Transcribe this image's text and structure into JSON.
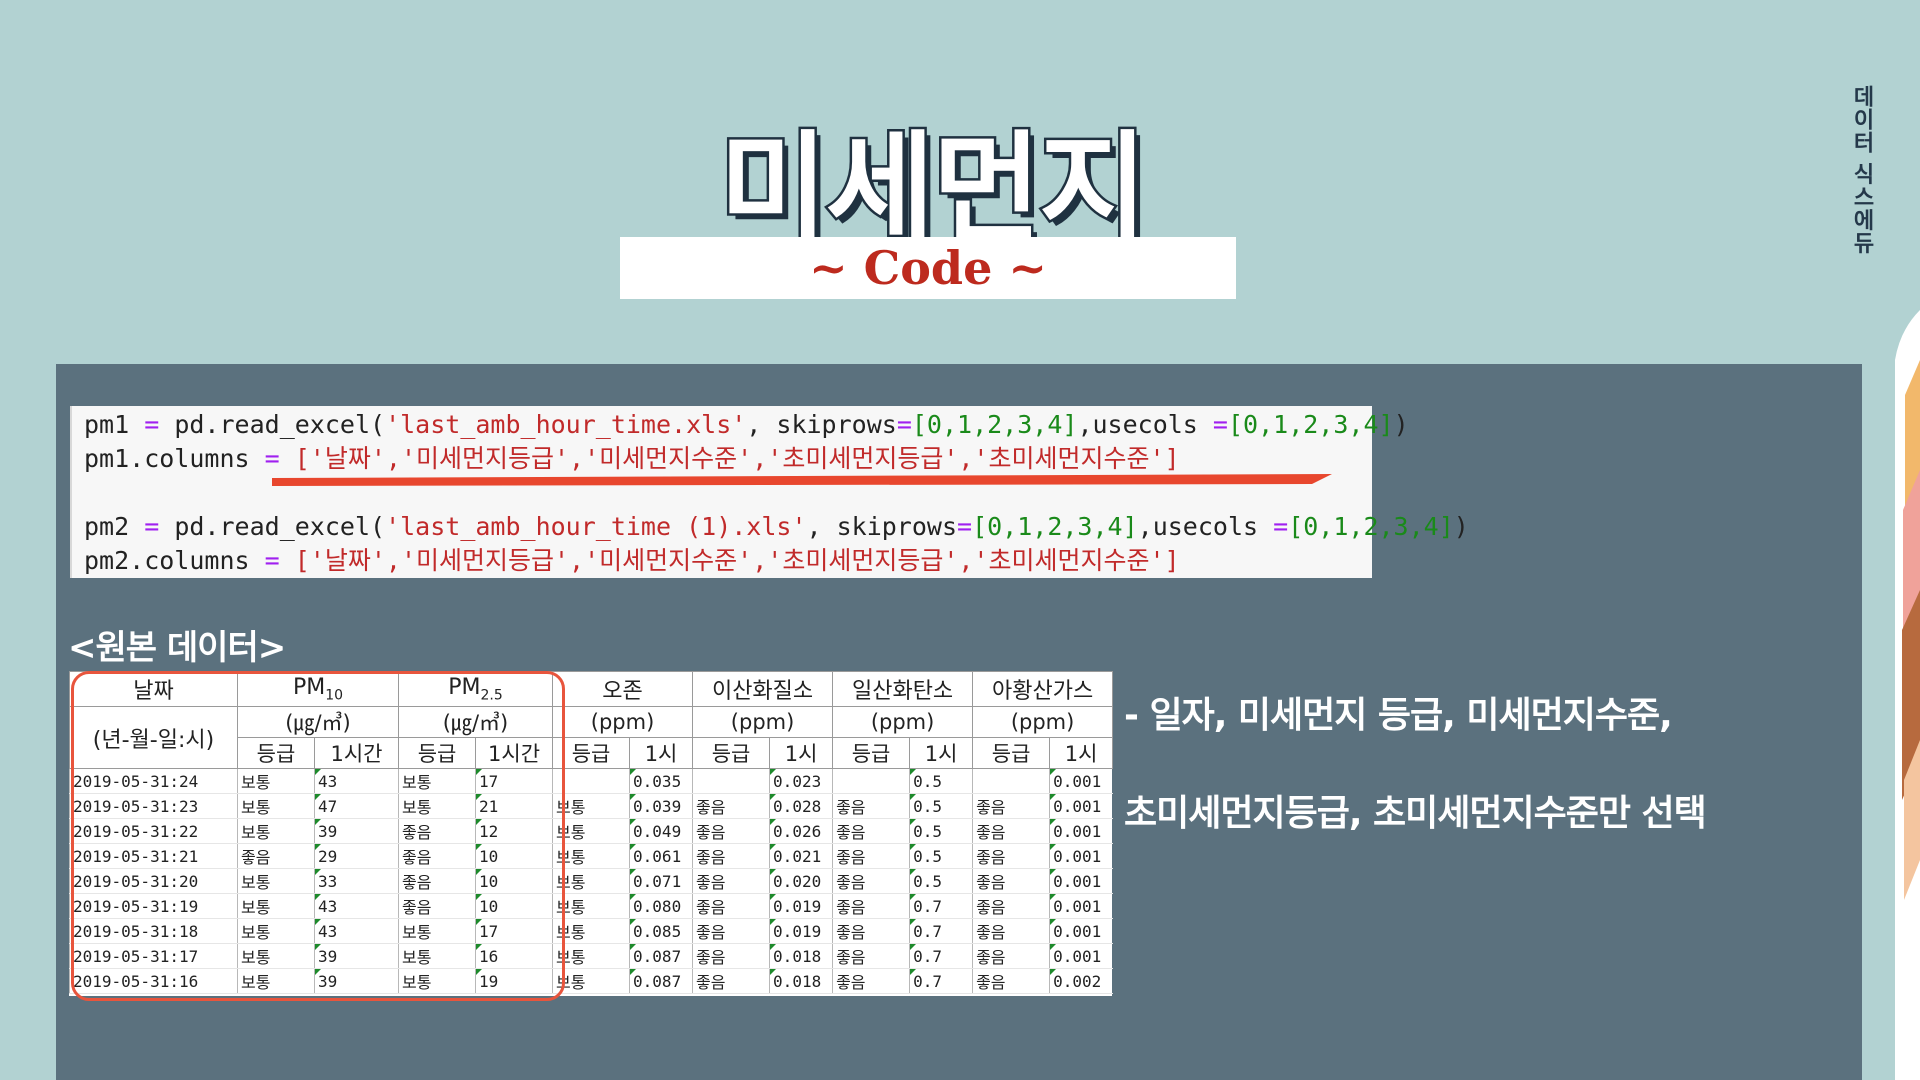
{
  "brand_vertical": "데이터 식스에듀",
  "title": "미세먼지",
  "subtitle": "~ Code ~",
  "code": {
    "line1": {
      "var": "pm1",
      "func": " pd.read_excel(",
      "file": "'last_amb_hour_time.xls'",
      "mid": ", skiprows",
      "list": "[0,1,2,3,4]",
      "mid2": ",usecols ",
      "list2": "[0,1,2,3,4]",
      "end": ")"
    },
    "line2": {
      "prefix": "pm1.columns ",
      "cols": "['날짜','미세먼지등급','미세먼지수준','초미세먼지등급','초미세먼지수준']"
    },
    "line3": {
      "var": "pm2",
      "func": " pd.read_excel(",
      "file": "'last_amb_hour_time (1).xls'",
      "mid": ", skiprows",
      "list": "[0,1,2,3,4]",
      "mid2": ",usecols ",
      "list2": "[0,1,2,3,4]",
      "end": ")"
    },
    "line4": {
      "prefix": "pm2.columns ",
      "cols": "['날짜','미세먼지등급','미세먼지수준','초미세먼지등급','초미세먼지수준']"
    }
  },
  "section_heading": "<원본 데이터>",
  "table": {
    "h1": {
      "date": "날짜",
      "pm10": "PM10",
      "pm25": "PM2.5",
      "ozone": "오존",
      "no2": "이산화질소",
      "co": "일산화탄소",
      "so2": "아황산가스"
    },
    "h2": {
      "date_fmt": "(년-월-일:시)",
      "unit_pm": "(㎍/㎥)",
      "unit_ppm": "(ppm)"
    },
    "h3": {
      "grade": "등급",
      "hour1": "1시간",
      "h1": "1시"
    },
    "rows": [
      [
        "2019-05-31:24",
        "보통",
        "43",
        "보통",
        "17",
        "",
        "0.035",
        "",
        "0.023",
        "",
        "0.5",
        "",
        "0.001"
      ],
      [
        "2019-05-31:23",
        "보통",
        "47",
        "보통",
        "21",
        "보통",
        "0.039",
        "좋음",
        "0.028",
        "좋음",
        "0.5",
        "좋음",
        "0.001"
      ],
      [
        "2019-05-31:22",
        "보통",
        "39",
        "좋음",
        "12",
        "보통",
        "0.049",
        "좋음",
        "0.026",
        "좋음",
        "0.5",
        "좋음",
        "0.001"
      ],
      [
        "2019-05-31:21",
        "좋음",
        "29",
        "좋음",
        "10",
        "보통",
        "0.061",
        "좋음",
        "0.021",
        "좋음",
        "0.5",
        "좋음",
        "0.001"
      ],
      [
        "2019-05-31:20",
        "보통",
        "33",
        "좋음",
        "10",
        "보통",
        "0.071",
        "좋음",
        "0.020",
        "좋음",
        "0.5",
        "좋음",
        "0.001"
      ],
      [
        "2019-05-31:19",
        "보통",
        "43",
        "좋음",
        "10",
        "보통",
        "0.080",
        "좋음",
        "0.019",
        "좋음",
        "0.7",
        "좋음",
        "0.001"
      ],
      [
        "2019-05-31:18",
        "보통",
        "43",
        "보통",
        "17",
        "보통",
        "0.085",
        "좋음",
        "0.019",
        "좋음",
        "0.7",
        "좋음",
        "0.001"
      ],
      [
        "2019-05-31:17",
        "보통",
        "39",
        "보통",
        "16",
        "보통",
        "0.087",
        "좋음",
        "0.018",
        "좋음",
        "0.7",
        "좋음",
        "0.001"
      ],
      [
        "2019-05-31:16",
        "보통",
        "39",
        "보통",
        "19",
        "보통",
        "0.087",
        "좋음",
        "0.018",
        "좋음",
        "0.7",
        "좋음",
        "0.002"
      ]
    ]
  },
  "description": {
    "line1": "- 일자, 미세먼지 등급, 미세먼지수준,",
    "line2": "초미세먼지등급, 초미세먼지수준만 선택"
  },
  "colors": {
    "background": "#b2d2d2",
    "panel": "#5b717e",
    "accent_red": "#e8553d",
    "title_outline": "#1f3140"
  }
}
